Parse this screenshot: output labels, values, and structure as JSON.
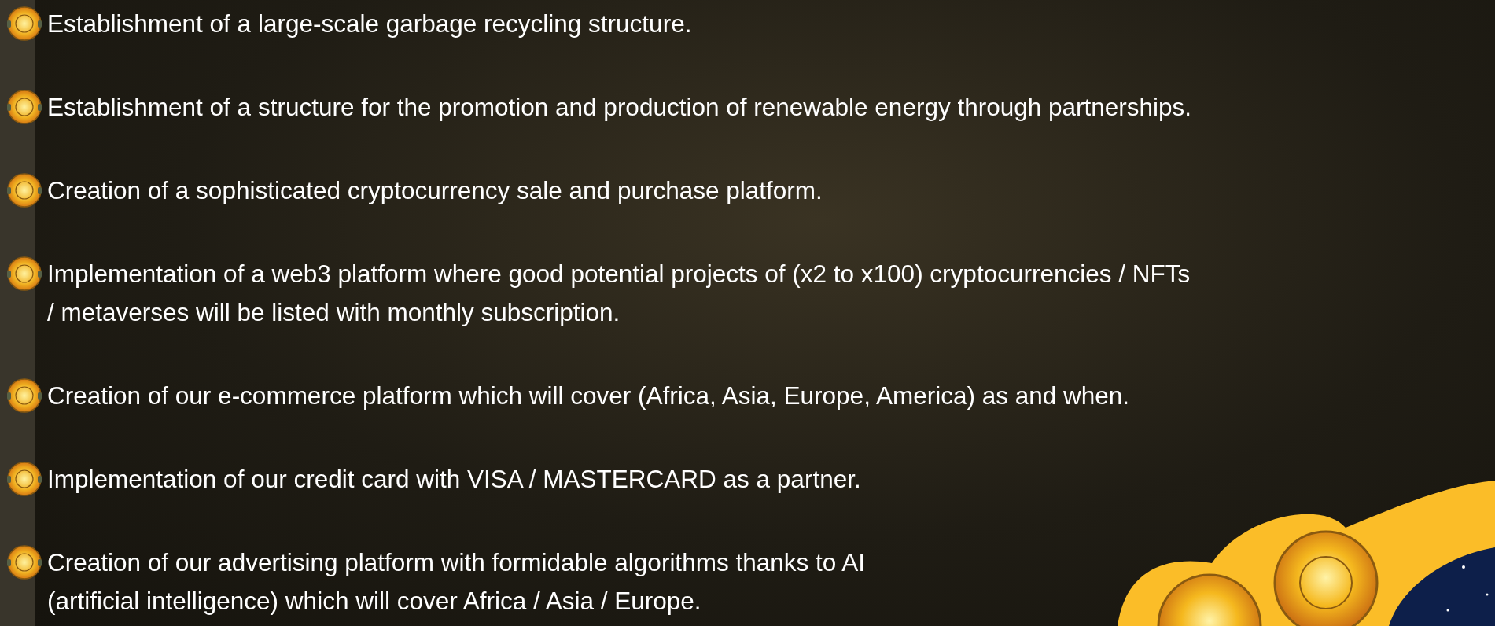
{
  "items": [
    {
      "lines": [
        "Establishment of a large-scale garbage recycling structure."
      ]
    },
    {
      "lines": [
        "Establishment of a structure for the promotion and production of renewable energy through partnerships."
      ]
    },
    {
      "lines": [
        "Creation of a sophisticated cryptocurrency sale and purchase platform."
      ]
    },
    {
      "lines": [
        "Implementation of a web3 platform where good potential projects of (x2 to x100) cryptocurrencies / NFTs",
        " / metaverses will be listed with monthly subscription."
      ]
    },
    {
      "lines": [
        "Creation of our e-commerce platform which will cover (Africa, Asia, Europe, America) as and when."
      ]
    },
    {
      "lines": [
        "Implementation of our credit card with VISA / MASTERCARD as a partner."
      ]
    },
    {
      "lines": [
        "Creation of our advertising platform with formidable algorithms thanks to AI",
        "(artificial intelligence) which will cover Africa / Asia / Europe."
      ]
    }
  ]
}
